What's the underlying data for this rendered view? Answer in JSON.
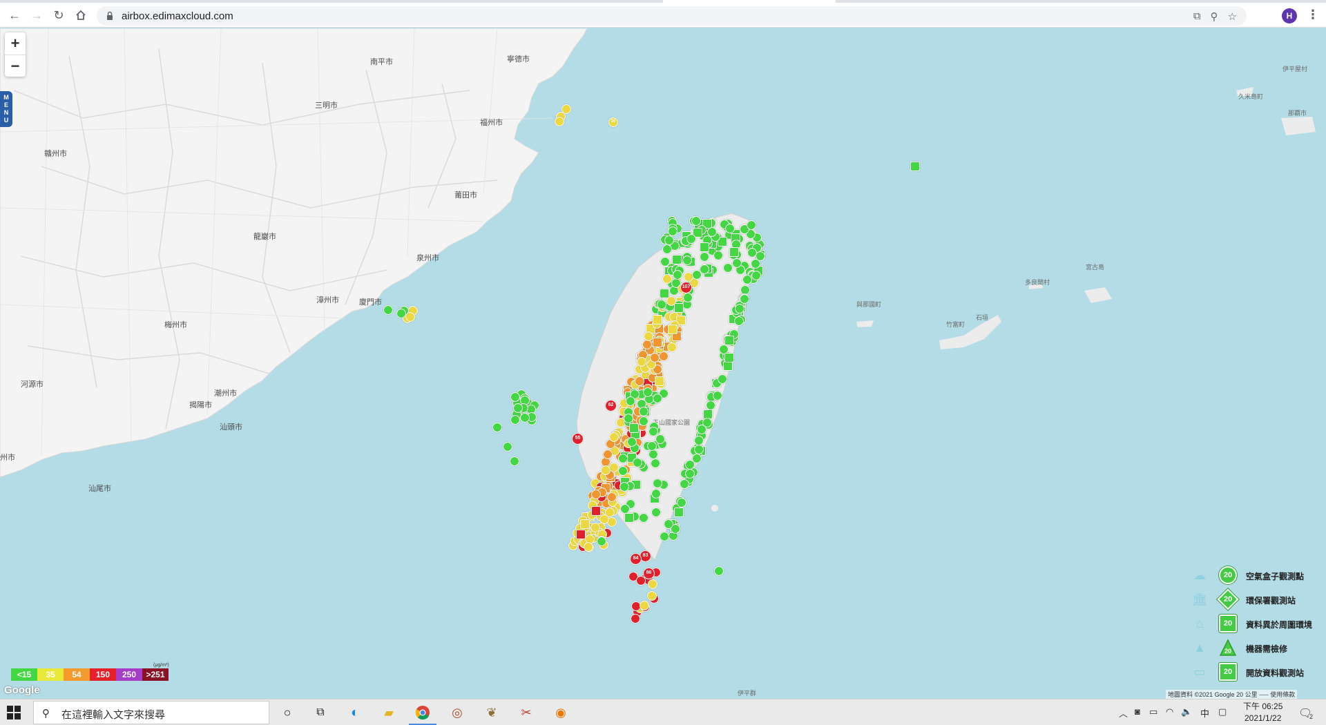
{
  "browser": {
    "url": "airbox.edimaxcloud.com",
    "profile_initial": "H"
  },
  "map": {
    "zoom_in": "+",
    "zoom_out": "−",
    "menu_tab": "M\nE\nN\nU",
    "places": [
      {
        "id": "p1",
        "name": "南平市"
      },
      {
        "id": "p2",
        "name": "寧德市"
      },
      {
        "id": "p3",
        "name": "三明市"
      },
      {
        "id": "p4",
        "name": "福州市"
      },
      {
        "id": "p5",
        "name": "贛州市"
      },
      {
        "id": "p6",
        "name": "莆田市"
      },
      {
        "id": "p7",
        "name": "龍巖市"
      },
      {
        "id": "p8",
        "name": "泉州市"
      },
      {
        "id": "p9",
        "name": "漳州市"
      },
      {
        "id": "p10",
        "name": "廈門市"
      },
      {
        "id": "p11",
        "name": "梅州市"
      },
      {
        "id": "p12",
        "name": "河源市"
      },
      {
        "id": "p13",
        "name": "潮州市"
      },
      {
        "id": "p14",
        "name": "揭陽市"
      },
      {
        "id": "p15",
        "name": "汕頭市"
      },
      {
        "id": "p16",
        "name": "汕尾市"
      },
      {
        "id": "p17",
        "name": "石垣"
      },
      {
        "id": "p18",
        "name": "宮古島"
      },
      {
        "id": "p19",
        "name": "與那國町"
      },
      {
        "id": "p20",
        "name": "竹富町"
      },
      {
        "id": "p21",
        "name": "多良間村"
      },
      {
        "id": "p22",
        "name": "那覇市"
      },
      {
        "id": "p23",
        "name": "久米島町"
      },
      {
        "id": "p24",
        "name": "伊平屋村"
      },
      {
        "id": "p25",
        "name": "州市"
      },
      {
        "id": "p26",
        "name": "玉山國家公園"
      },
      {
        "id": "p27",
        "name": "伊平群"
      }
    ],
    "stations": [
      {
        "c": "green",
        "v": "30"
      },
      {
        "c": "yellow",
        "v": "23"
      },
      {
        "c": "green",
        "v": "32"
      },
      {
        "c": "green",
        "v": "21"
      },
      {
        "c": "yellow",
        "v": "107"
      },
      {
        "c": "red",
        "v": "107"
      },
      {
        "c": "orange",
        "v": "62"
      },
      {
        "c": "red",
        "v": "55"
      },
      {
        "c": "red",
        "v": "83"
      },
      {
        "c": "red",
        "v": "84"
      },
      {
        "c": "red",
        "v": "86"
      },
      {
        "c": "yellow",
        "v": "27"
      }
    ]
  },
  "scale": {
    "unit": "(μg/m³)",
    "cells": [
      {
        "label": "<15",
        "color": "#43d843"
      },
      {
        "label": "35",
        "color": "#e9e93a"
      },
      {
        "label": "54",
        "color": "#f29a2e"
      },
      {
        "label": "150",
        "color": "#e5202a"
      },
      {
        "label": "250",
        "color": "#a63dc6"
      },
      {
        "label": ">251",
        "color": "#8b1226"
      }
    ]
  },
  "legend": {
    "badge_value": "20",
    "items": [
      {
        "label": "空氣盒子觀測點",
        "shape": "circle",
        "icon": "cloud-icon"
      },
      {
        "label": "環保署觀測站",
        "shape": "diamond",
        "icon": "government-building-icon"
      },
      {
        "label": "資料異於周圍環境",
        "shape": "house",
        "icon": "house-icon"
      },
      {
        "label": "機器需檢修",
        "shape": "tri",
        "icon": "cone-icon"
      },
      {
        "label": "開放資料觀測站",
        "shape": "square",
        "icon": "folder-icon"
      }
    ]
  },
  "map_footer": {
    "google": "Google",
    "attribution": "地圖資料 ©2021 Google   20 公里 ⎯⎯⎯   使用條款"
  },
  "taskbar": {
    "search_placeholder": "在這裡輸入文字來搜尋",
    "ime": "中",
    "time": "下午 06:25",
    "date": "2021/1/22",
    "notification_count": "2"
  },
  "colors": {
    "green": "#43d843",
    "yellow": "#ecd840",
    "orange": "#f0952f",
    "red": "#e0202a",
    "sea": "#b3dce6",
    "land": "#f4f4f4"
  }
}
